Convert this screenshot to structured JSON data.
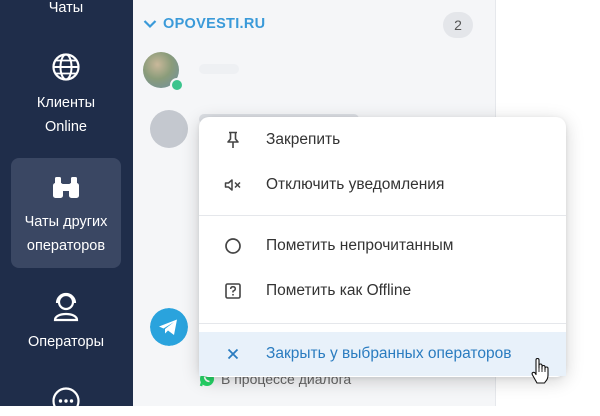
{
  "sidebar": {
    "items": [
      {
        "label": "Чаты",
        "icon": "chat-bubble-icon"
      },
      {
        "label": "Клиенты Online",
        "icon": "globe-icon"
      },
      {
        "label": "Чаты других операторов",
        "icon": "binoculars-icon",
        "active": true
      },
      {
        "label": "Операторы",
        "icon": "operator-headset-icon"
      },
      {
        "label": "",
        "icon": "more-dots-icon"
      }
    ]
  },
  "group": {
    "title": "OPOVESTI.RU",
    "count": "2"
  },
  "chat": {
    "status_text": "В процессе диалога"
  },
  "context_menu": {
    "items": [
      {
        "label": "Закрепить",
        "icon": "pin-icon"
      },
      {
        "label": "Отключить уведомления",
        "icon": "mute-icon"
      },
      {
        "label": "Пометить непрочитанным",
        "icon": "circle-icon"
      },
      {
        "label": "Пометить как Offline",
        "icon": "question-box-icon"
      },
      {
        "label": "Закрыть у выбранных операторов",
        "icon": "close-icon",
        "highlighted": true
      }
    ]
  },
  "colors": {
    "sidebar_bg": "#1f2d4a",
    "sidebar_active": "#3a4763",
    "accent": "#3a9ad9",
    "online": "#3bc48d",
    "highlight_bg": "#e8f1fa",
    "telegram": "#2aa3dd",
    "whatsapp": "#25d366"
  }
}
